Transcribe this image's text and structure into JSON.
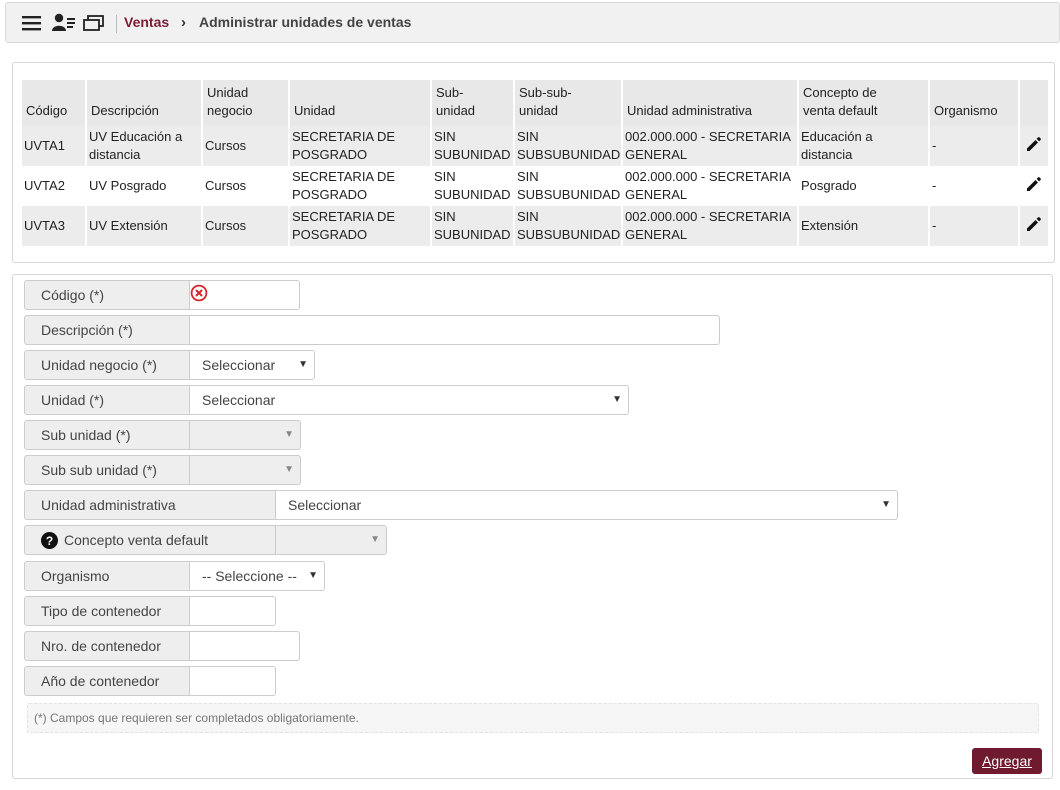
{
  "header": {
    "breadcrumb_root": "Ventas",
    "breadcrumb_separator": "›",
    "page_title": "Administrar unidades de ventas",
    "icons": [
      "menu-icon",
      "user-list-icon",
      "windows-icon"
    ]
  },
  "table": {
    "columns": [
      "Código",
      "Descripción",
      "Unidad negocio",
      "Unidad",
      "Sub-unidad",
      "Sub-sub-unidad",
      "Unidad administrativa",
      "Concepto de venta default",
      "Organismo",
      ""
    ],
    "column_lines": [
      [
        "Código"
      ],
      [
        "Descripción"
      ],
      [
        "Unidad",
        "negocio"
      ],
      [
        "Unidad"
      ],
      [
        "Sub-",
        "unidad"
      ],
      [
        "Sub-sub-",
        "unidad"
      ],
      [
        "Unidad administrativa"
      ],
      [
        "Concepto de",
        "venta default"
      ],
      [
        "Organismo"
      ],
      [
        ""
      ]
    ],
    "rows": [
      {
        "codigo": "UVTA1",
        "descripcion": [
          "UV Educación a",
          "distancia"
        ],
        "unidad_negocio": "Cursos",
        "unidad": [
          "SECRETARIA DE",
          "POSGRADO"
        ],
        "subunidad": [
          "SIN",
          "SUBUNIDAD"
        ],
        "subsubunidad": [
          "SIN",
          "SUBSUBUNIDAD"
        ],
        "unidad_administrativa": [
          "002.000.000 - SECRETARIA",
          "GENERAL"
        ],
        "concepto": [
          "Educación a",
          "distancia"
        ],
        "organismo": "-"
      },
      {
        "codigo": "UVTA2",
        "descripcion": [
          "UV Posgrado"
        ],
        "unidad_negocio": "Cursos",
        "unidad": [
          "SECRETARIA DE",
          "POSGRADO"
        ],
        "subunidad": [
          "SIN",
          "SUBUNIDAD"
        ],
        "subsubunidad": [
          "SIN",
          "SUBSUBUNIDAD"
        ],
        "unidad_administrativa": [
          "002.000.000 - SECRETARIA",
          "GENERAL"
        ],
        "concepto": [
          "Posgrado"
        ],
        "organismo": "-"
      },
      {
        "codigo": "UVTA3",
        "descripcion": [
          "UV Extensión"
        ],
        "unidad_negocio": "Cursos",
        "unidad": [
          "SECRETARIA DE",
          "POSGRADO"
        ],
        "subunidad": [
          "SIN",
          "SUBUNIDAD"
        ],
        "subsubunidad": [
          "SIN",
          "SUBSUBUNIDAD"
        ],
        "unidad_administrativa": [
          "002.000.000 - SECRETARIA",
          "GENERAL"
        ],
        "concepto": [
          "Extensión"
        ],
        "organismo": "-"
      }
    ],
    "row_action_icon": "pencil-icon"
  },
  "form": {
    "codigo": {
      "label": "Código (*)",
      "value": "",
      "status_icon": "error-icon"
    },
    "descripcion": {
      "label": "Descripción (*)",
      "value": ""
    },
    "unidad_negocio": {
      "label": "Unidad negocio (*)",
      "selected": "Seleccionar"
    },
    "unidad": {
      "label": "Unidad (*)",
      "selected": "Seleccionar"
    },
    "sub_unidad": {
      "label": "Sub unidad (*)",
      "selected": ""
    },
    "sub_sub_unidad": {
      "label": "Sub sub unidad (*)",
      "selected": ""
    },
    "unidad_administrativa": {
      "label": "Unidad administrativa",
      "selected": "Seleccionar"
    },
    "concepto_venta_default": {
      "label": "Concepto venta default",
      "selected": "",
      "help_icon": "question-circle-icon"
    },
    "organismo": {
      "label": "Organismo",
      "selected": "-- Seleccione --"
    },
    "tipo_contenedor": {
      "label": "Tipo de contenedor",
      "value": ""
    },
    "nro_contenedor": {
      "label": "Nro. de contenedor",
      "value": ""
    },
    "anio_contenedor": {
      "label": "Año de contenedor",
      "value": ""
    },
    "required_note": "(*) Campos que requieren ser completados obligatoriamente.",
    "submit_label": "Agregar"
  },
  "colors": {
    "brand": "#7b1c33",
    "button": "#6f1a2f",
    "error": "#d9232d"
  }
}
